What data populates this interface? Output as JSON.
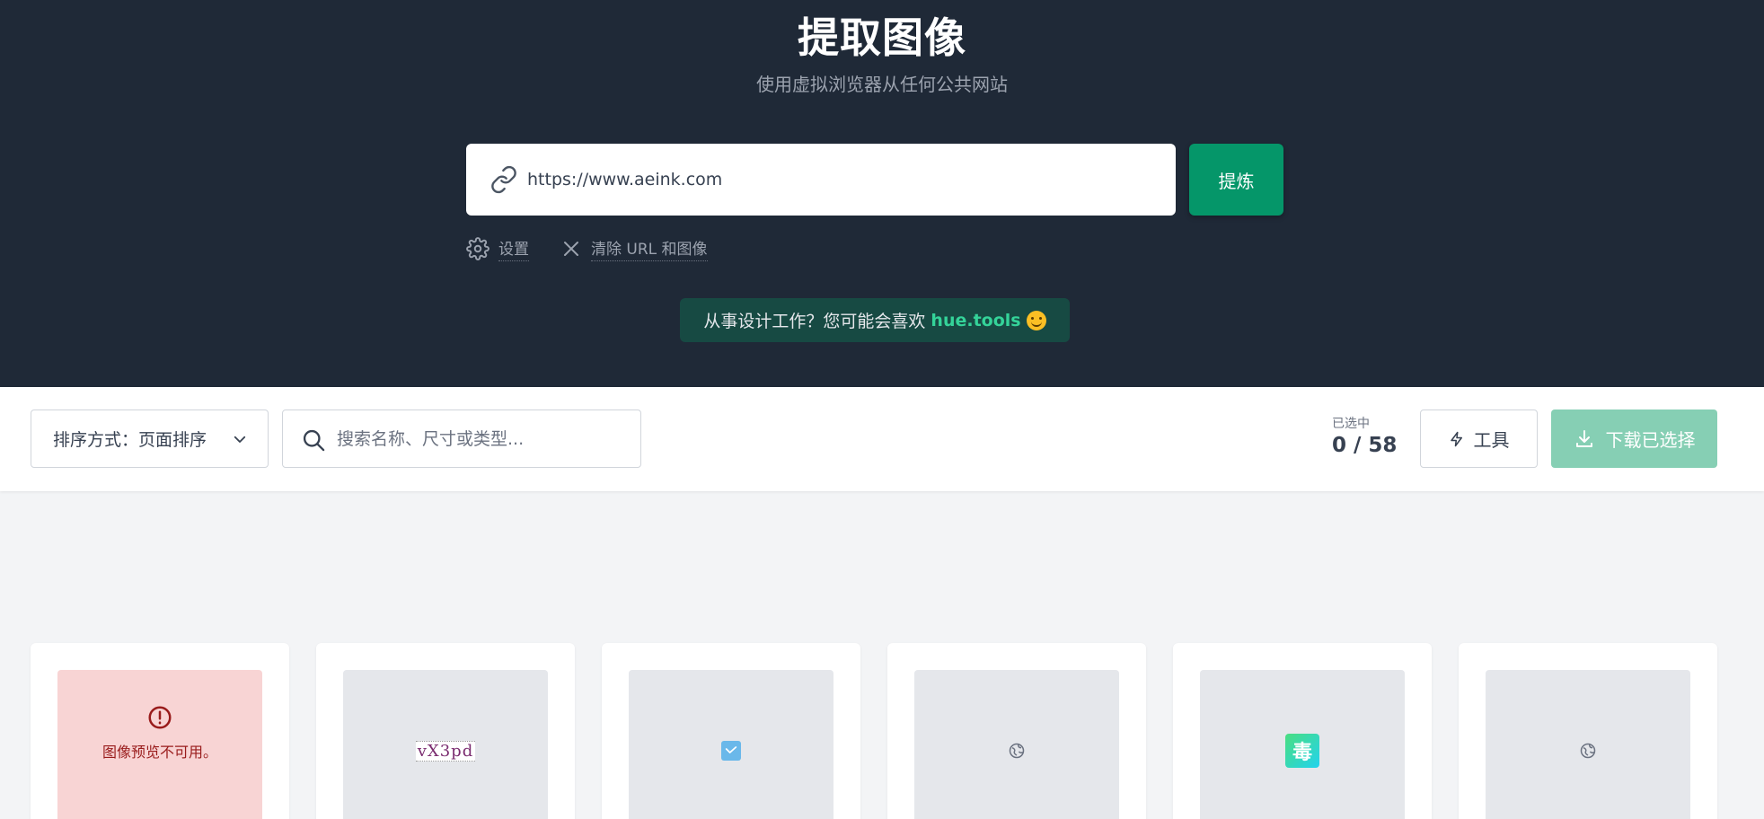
{
  "hero": {
    "title": "提取图像",
    "subtitle": "使用虚拟浏览器从任何公共网站",
    "url_value": "https://www.aeink.com",
    "extract_label": "提炼",
    "settings_label": "设置",
    "clear_label": "清除 URL 和图像",
    "promo_text": "从事设计工作？您可能会喜欢",
    "promo_link": "hue.tools"
  },
  "toolbar": {
    "sort_label": "排序方式：页面排序",
    "search_placeholder": "搜索名称、尺寸或类型...",
    "selected_label": "已选中",
    "selected_count": "0 / 58",
    "tools_label": "工具",
    "download_label": "下载已选择"
  },
  "cards": [
    {
      "kind": "error",
      "text": "图像预览不可用。"
    },
    {
      "kind": "captcha",
      "text": "vX3pd"
    },
    {
      "kind": "small-icon"
    },
    {
      "kind": "globe-icon"
    },
    {
      "kind": "app-icon",
      "text": "毒"
    },
    {
      "kind": "globe-icon"
    }
  ],
  "colors": {
    "hero_bg": "#1f2937",
    "accent": "#059669",
    "accent_disabled": "#86cfb4",
    "promo_bg": "#174a43",
    "promo_link": "#34d399",
    "error_bg": "#f8d4d4"
  }
}
